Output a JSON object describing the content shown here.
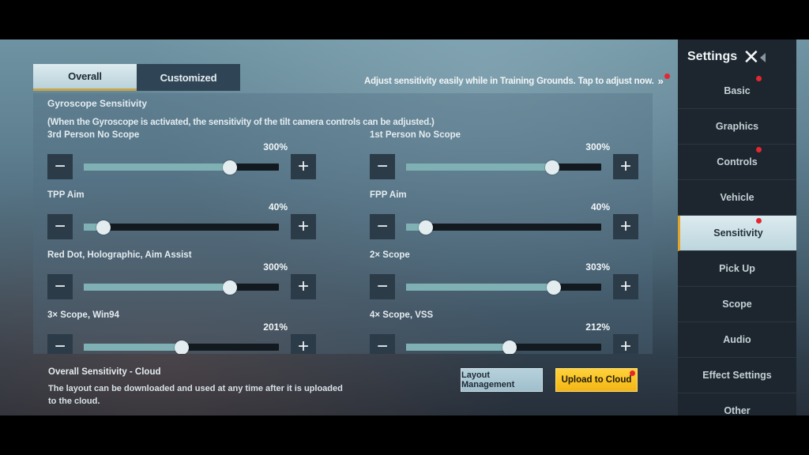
{
  "tabs": [
    {
      "label": "Overall",
      "active": true
    },
    {
      "label": "Customized",
      "active": false
    }
  ],
  "hint": {
    "text": "Adjust sensitivity easily while in Training Grounds. Tap to adjust now.",
    "chevron": "»",
    "has_notification": true
  },
  "gyroscope": {
    "title": "Gyroscope Sensitivity",
    "description": "(When the Gyroscope is activated, the sensitivity of the tilt camera controls can be adjusted.)"
  },
  "slider_range_percent": [
    0,
    400
  ],
  "settings": [
    {
      "label": "3rd Person No Scope",
      "value_text": "300%",
      "value": 300
    },
    {
      "label": "1st Person No Scope",
      "value_text": "300%",
      "value": 300
    },
    {
      "label": "TPP Aim",
      "value_text": "40%",
      "value": 40
    },
    {
      "label": "FPP Aim",
      "value_text": "40%",
      "value": 40
    },
    {
      "label": "Red Dot, Holographic, Aim Assist",
      "value_text": "300%",
      "value": 300
    },
    {
      "label": "2× Scope",
      "value_text": "303%",
      "value": 303
    },
    {
      "label": "3× Scope, Win94",
      "value_text": "201%",
      "value": 201
    },
    {
      "label": "4× Scope, VSS",
      "value_text": "212%",
      "value": 212
    }
  ],
  "buttons": {
    "minus_icon": "−",
    "plus_icon": "+"
  },
  "footer": {
    "title": "Overall Sensitivity - Cloud",
    "description": "The layout can be downloaded and used at any time after it is uploaded to the cloud.",
    "layout_button": "Layout Management",
    "upload_button": "Upload to Cloud"
  },
  "sidebar": {
    "title": "Settings",
    "close_icon": "✕",
    "items": [
      {
        "label": "Basic",
        "active": false,
        "notify": true
      },
      {
        "label": "Graphics",
        "active": false,
        "notify": false
      },
      {
        "label": "Controls",
        "active": false,
        "notify": true
      },
      {
        "label": "Vehicle",
        "active": false,
        "notify": false
      },
      {
        "label": "Sensitivity",
        "active": true,
        "notify": true
      },
      {
        "label": "Pick Up",
        "active": false,
        "notify": false
      },
      {
        "label": "Scope",
        "active": false,
        "notify": false
      },
      {
        "label": "Audio",
        "active": false,
        "notify": false
      },
      {
        "label": "Effect Settings",
        "active": false,
        "notify": false
      },
      {
        "label": "Other",
        "active": false,
        "notify": false
      }
    ]
  },
  "colors": {
    "accent_gold": "#e1a52a",
    "upload_yellow": "#ffd23a",
    "slider_fill": "#7fb1b4",
    "notification_red": "#e6262e"
  }
}
